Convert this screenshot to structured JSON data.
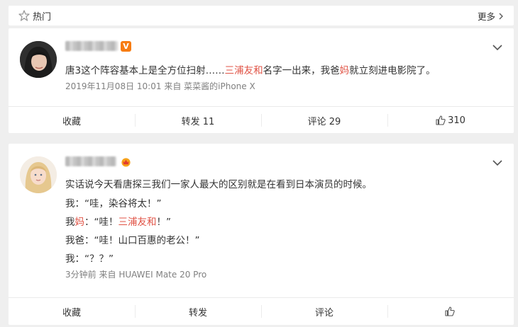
{
  "topbar": {
    "label": "热门",
    "more": "更多"
  },
  "posts": [
    {
      "text": {
        "a": "唐3这个阵容基本上是全方位扫射……",
        "b": "三浦友和",
        "c": "名字一出来，我爸",
        "d": "妈",
        "e": "就立刻进电影院了。"
      },
      "meta": {
        "time": "2019年11月08日 10:01",
        "from": "来自",
        "source": "菜菜酱的iPhone X"
      },
      "actions": {
        "collect": "收藏",
        "repost": "转发 11",
        "comment": "评论 29",
        "like": "310"
      }
    },
    {
      "lines": {
        "l1": "实话说今天看唐探三我们一家人最大的区别就是在看到日本演员的时候。",
        "l2": "我：“哇，染谷将太！”",
        "l3a": "我",
        "l3b": "妈",
        "l3c": "：“哇！",
        "l3d": "三浦友和",
        "l3e": "！”",
        "l4": "我爸：“哇！山口百惠的老公！”",
        "l5": "我：“？？”"
      },
      "meta": {
        "time": "3分钟前",
        "from": "来自",
        "source": "HUAWEI Mate 20 Pro"
      },
      "actions": {
        "collect": "收藏",
        "repost": "转发",
        "comment": "评论",
        "like": ""
      }
    }
  ],
  "colors": {
    "highlight": "#e05244",
    "vip": "#f77c13"
  }
}
